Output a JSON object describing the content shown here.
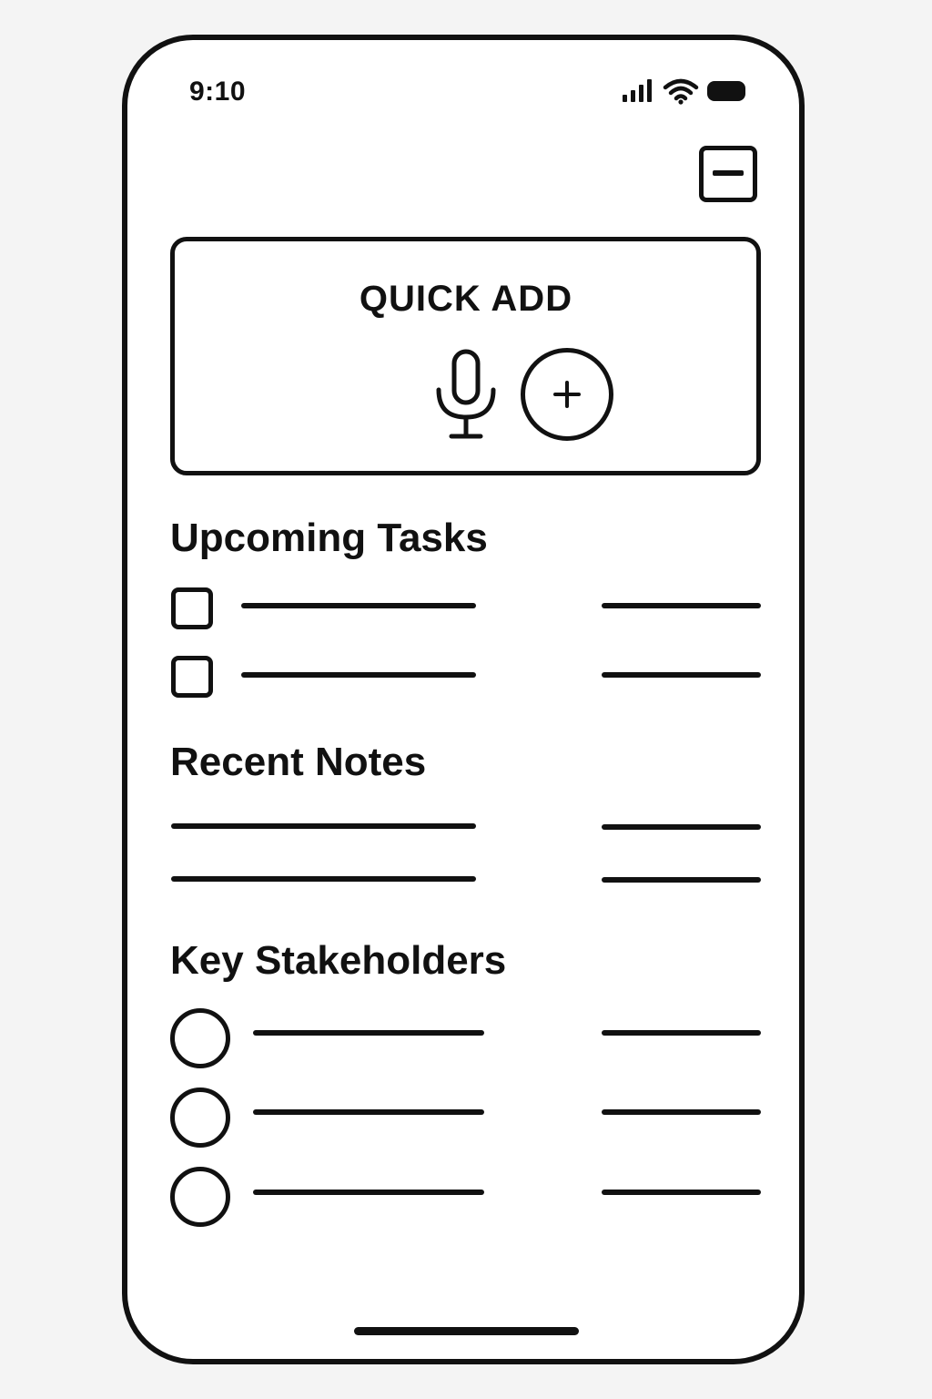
{
  "status_bar": {
    "time": "9:10",
    "icons": [
      "signal-icon",
      "wifi-icon",
      "battery-icon"
    ]
  },
  "header": {
    "collapse_icon": "minus-square-icon"
  },
  "quick_add": {
    "title": "QUICK ADD",
    "icons": [
      "microphone-icon",
      "plus-circle-icon"
    ]
  },
  "upcoming_tasks": {
    "title": "Upcoming Tasks",
    "row_count": 2
  },
  "recent_notes": {
    "title": "Recent Notes",
    "row_count": 2
  },
  "key_stakeholders": {
    "title": "Key Stakeholders",
    "row_count": 3
  },
  "colors": {
    "ink": "#111111",
    "background": "#f4f4f4",
    "screen": "#ffffff"
  }
}
